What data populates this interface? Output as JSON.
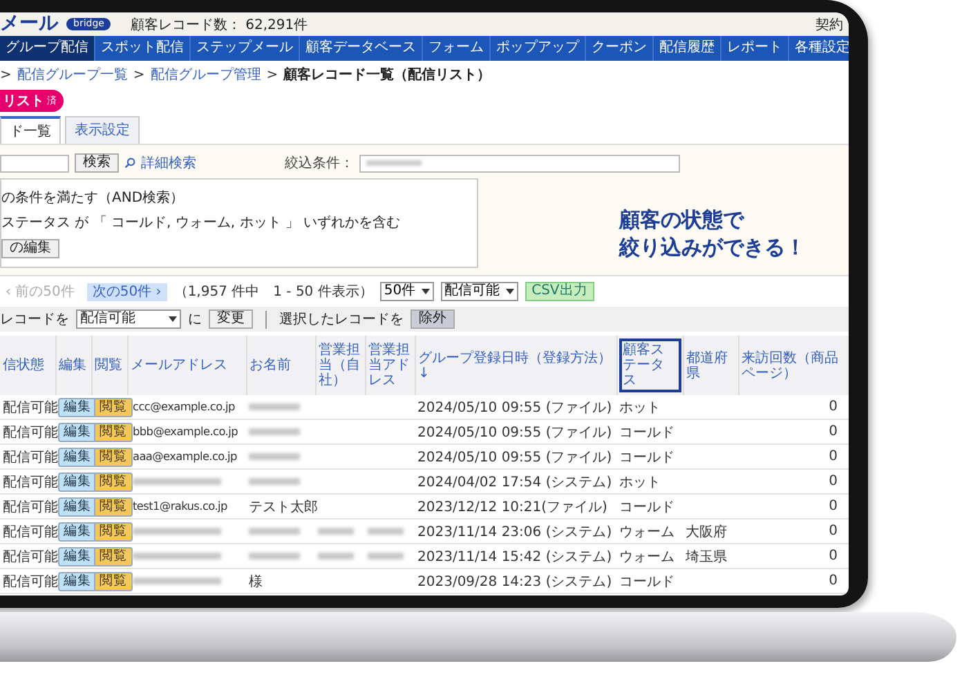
{
  "header": {
    "brand": "メール",
    "badge": "bridge",
    "record_count": "顧客レコード数： 62,291件",
    "contract": "契約"
  },
  "nav": [
    {
      "label": "グループ配信",
      "selected": true
    },
    {
      "label": "スポット配信",
      "selected": false
    },
    {
      "label": "ステップメール",
      "selected": false
    },
    {
      "label": "顧客データベース",
      "selected": false
    },
    {
      "label": "フォーム",
      "selected": false
    },
    {
      "label": "ポップアップ",
      "selected": false
    },
    {
      "label": "クーポン",
      "selected": false
    },
    {
      "label": "配信履歴",
      "selected": false
    },
    {
      "label": "レポート",
      "selected": false
    },
    {
      "label": "各種設定",
      "selected": false
    }
  ],
  "breadcrumb": {
    "separator": ">",
    "links": [
      "配信グループ一覧",
      "配信グループ管理"
    ],
    "current": "顧客レコード一覧（配信リスト）"
  },
  "page_title": {
    "text": "リスト",
    "badge": "済"
  },
  "tabs": [
    {
      "label": "ド一覧",
      "selected": true
    },
    {
      "label": "表示設定",
      "selected": false
    }
  ],
  "search": {
    "button": "検索",
    "advanced_link": "詳細検索",
    "filter_label": "絞込条件："
  },
  "conditions": {
    "mode": "の条件を満たす（AND検索）",
    "rule": "ステータス が 「 コールド, ウォーム, ホット 」 いずれかを含む",
    "edit_button": "の編集"
  },
  "callout": [
    "顧客の状態で",
    "絞り込みができる！"
  ],
  "pager": {
    "prev": {
      "label": "‹ 前の50件",
      "disabled": true
    },
    "next": {
      "label": "次の50件 ›",
      "disabled": false
    },
    "summary": "（1,957 件中　1 - 50 件表示）",
    "per_page": "50件",
    "status_filter": "配信可能",
    "csv": "CSV出力"
  },
  "bulk": {
    "label": "レコードを",
    "select": "配信可能",
    "particle": "に",
    "change": "変更",
    "selected_label": "選択したレコードを",
    "exclude": "除外"
  },
  "table": {
    "columns": [
      {
        "label": "信状態",
        "highlighted": false
      },
      {
        "label": "編集",
        "highlighted": false
      },
      {
        "label": "閲覧",
        "highlighted": false
      },
      {
        "label": "メールアドレス",
        "highlighted": false
      },
      {
        "label": "お名前",
        "highlighted": false
      },
      {
        "label": "営業担当（自社）",
        "highlighted": false
      },
      {
        "label": "営業担当アドレス",
        "highlighted": false
      },
      {
        "label": "グループ登録日時（登録方法）↓",
        "highlighted": false
      },
      {
        "label": "顧客ステータス",
        "highlighted": true
      },
      {
        "label": "都道府県",
        "highlighted": false
      },
      {
        "label": "来訪回数（商品ページ）",
        "highlighted": false
      }
    ],
    "rows": [
      {
        "cells": [
          {
            "kind": "text",
            "text": "配信可能"
          },
          {
            "kind": "edit",
            "text": "編集"
          },
          {
            "kind": "view",
            "text": "閲覧"
          },
          {
            "kind": "text",
            "text": "ccc@example.co.jp"
          },
          {
            "kind": "blurred"
          },
          {
            "kind": "empty"
          },
          {
            "kind": "empty"
          },
          {
            "kind": "text",
            "text": "2024/05/10 09:55 (ファイル)"
          },
          {
            "kind": "text",
            "text": "ホット"
          },
          {
            "kind": "empty"
          },
          {
            "kind": "number",
            "text": "0"
          }
        ]
      },
      {
        "cells": [
          {
            "kind": "text",
            "text": "配信可能"
          },
          {
            "kind": "edit",
            "text": "編集"
          },
          {
            "kind": "view",
            "text": "閲覧"
          },
          {
            "kind": "text",
            "text": "bbb@example.co.jp"
          },
          {
            "kind": "blurred"
          },
          {
            "kind": "empty"
          },
          {
            "kind": "empty"
          },
          {
            "kind": "text",
            "text": "2024/05/10 09:55 (ファイル)"
          },
          {
            "kind": "text",
            "text": "コールド"
          },
          {
            "kind": "empty"
          },
          {
            "kind": "number",
            "text": "0"
          }
        ]
      },
      {
        "cells": [
          {
            "kind": "text",
            "text": "配信可能"
          },
          {
            "kind": "edit",
            "text": "編集"
          },
          {
            "kind": "view",
            "text": "閲覧"
          },
          {
            "kind": "text",
            "text": "aaa@example.co.jp"
          },
          {
            "kind": "blurred"
          },
          {
            "kind": "empty"
          },
          {
            "kind": "empty"
          },
          {
            "kind": "text",
            "text": "2024/05/10 09:55 (ファイル)"
          },
          {
            "kind": "text",
            "text": "コールド"
          },
          {
            "kind": "empty"
          },
          {
            "kind": "number",
            "text": "0"
          }
        ]
      },
      {
        "cells": [
          {
            "kind": "text",
            "text": "配信可能"
          },
          {
            "kind": "edit",
            "text": "編集"
          },
          {
            "kind": "view",
            "text": "閲覧"
          },
          {
            "kind": "blurred"
          },
          {
            "kind": "blurred"
          },
          {
            "kind": "empty"
          },
          {
            "kind": "empty"
          },
          {
            "kind": "text",
            "text": "2024/04/02 17:54 (システム)"
          },
          {
            "kind": "text",
            "text": "ホット"
          },
          {
            "kind": "empty"
          },
          {
            "kind": "number",
            "text": "0"
          }
        ]
      },
      {
        "cells": [
          {
            "kind": "text",
            "text": "配信可能"
          },
          {
            "kind": "edit",
            "text": "編集"
          },
          {
            "kind": "view",
            "text": "閲覧"
          },
          {
            "kind": "text",
            "text": "test1@rakus.co.jp"
          },
          {
            "kind": "text",
            "text": "テスト太郎"
          },
          {
            "kind": "empty"
          },
          {
            "kind": "empty"
          },
          {
            "kind": "text",
            "text": "2023/12/12 10:21(ファイル)"
          },
          {
            "kind": "text",
            "text": "コールド"
          },
          {
            "kind": "empty"
          },
          {
            "kind": "number",
            "text": "0"
          }
        ]
      },
      {
        "cells": [
          {
            "kind": "text",
            "text": "配信可能"
          },
          {
            "kind": "edit",
            "text": "編集"
          },
          {
            "kind": "view",
            "text": "閲覧"
          },
          {
            "kind": "blurred"
          },
          {
            "kind": "blurred"
          },
          {
            "kind": "blurred"
          },
          {
            "kind": "blurred"
          },
          {
            "kind": "text",
            "text": "2023/11/14 23:06 (システム)"
          },
          {
            "kind": "text",
            "text": "ウォーム"
          },
          {
            "kind": "text",
            "text": "大阪府"
          },
          {
            "kind": "number",
            "text": "0"
          }
        ]
      },
      {
        "cells": [
          {
            "kind": "text",
            "text": "配信可能"
          },
          {
            "kind": "edit",
            "text": "編集"
          },
          {
            "kind": "view",
            "text": "閲覧"
          },
          {
            "kind": "blurred"
          },
          {
            "kind": "blurred"
          },
          {
            "kind": "blurred"
          },
          {
            "kind": "blurred"
          },
          {
            "kind": "text",
            "text": "2023/11/14 15:42 (システム)"
          },
          {
            "kind": "text",
            "text": "ウォーム"
          },
          {
            "kind": "text",
            "text": "埼玉県"
          },
          {
            "kind": "number",
            "text": "0"
          }
        ]
      },
      {
        "cells": [
          {
            "kind": "text",
            "text": "配信可能"
          },
          {
            "kind": "edit",
            "text": "編集"
          },
          {
            "kind": "view",
            "text": "閲覧"
          },
          {
            "kind": "blurred"
          },
          {
            "kind": "text",
            "text": "様"
          },
          {
            "kind": "empty"
          },
          {
            "kind": "empty"
          },
          {
            "kind": "text",
            "text": "2023/09/28 14:23 (システム)"
          },
          {
            "kind": "text",
            "text": "コールド"
          },
          {
            "kind": "empty"
          },
          {
            "kind": "number",
            "text": "0"
          }
        ]
      }
    ]
  }
}
